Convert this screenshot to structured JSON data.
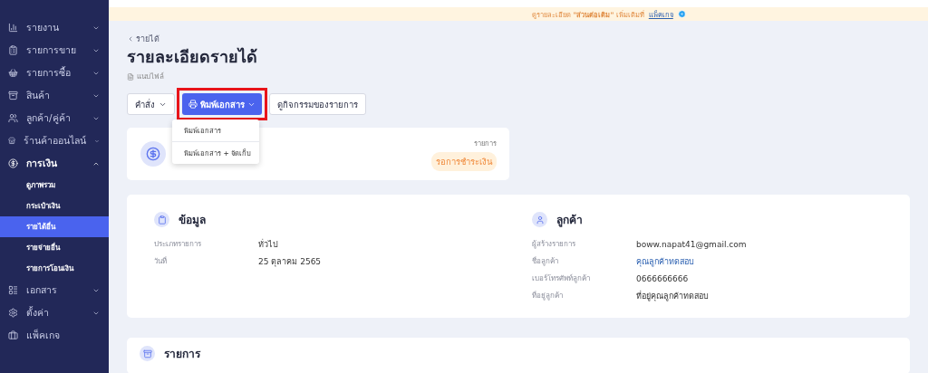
{
  "sidebar": {
    "items": [
      {
        "label": "รายงาน",
        "expanded": false
      },
      {
        "label": "รายการขาย",
        "expanded": false
      },
      {
        "label": "รายการซื้อ",
        "expanded": false
      },
      {
        "label": "สินค้า",
        "expanded": false
      },
      {
        "label": "ลูกค้า/คู่ค้า",
        "expanded": false
      },
      {
        "label": "ร้านค้าออนไลน์",
        "expanded": false
      },
      {
        "label": "การเงิน",
        "expanded": true,
        "children": [
          {
            "label": "ดูภาพรวม",
            "selected": false
          },
          {
            "label": "กระเป๋าเงิน",
            "selected": false
          },
          {
            "label": "รายได้อื่น",
            "selected": true
          },
          {
            "label": "รายจ่ายอื่น",
            "selected": false
          },
          {
            "label": "รายการโอนเงิน",
            "selected": false
          }
        ]
      },
      {
        "label": "เอกสาร",
        "expanded": false
      },
      {
        "label": "ตั้งค่า",
        "expanded": false
      },
      {
        "label": "แพ็คเกจ"
      }
    ]
  },
  "banner": {
    "text": "ดูรายละเอียด **\"ส่วนต่อเติม\"** เพิ่มเติมที่",
    "link": "แพ็คเกจ"
  },
  "breadcrumb": "รายได้",
  "title": "รายละเอียดรายได้",
  "file_link": "แนบไฟล์",
  "toolbar": {
    "command": "คำสั่ง",
    "print": {
      "label": "พิมพ์เอกสาร",
      "highlighted": true
    },
    "activity": "ดูกิจกรรมของรายการ"
  },
  "print_menu": {
    "items": [
      "พิมพ์เอกสาร",
      "พิมพ์เอกสาร + จัดเก็บ"
    ]
  },
  "status_card": {
    "label": "รายการ",
    "status": "รอการชำระเงิน"
  },
  "info": {
    "title": "ข้อมูล",
    "rows": [
      {
        "label": "ประเภทรายการ",
        "value": "ทั่วไป"
      },
      {
        "label": "วันที่",
        "value": "25 ตุลาคม 2565"
      }
    ]
  },
  "customer": {
    "title": "ลูกค้า",
    "rows": [
      {
        "label": "ผู้สร้างรายการ",
        "value": "boww.napat41@gmail.com",
        "link": false
      },
      {
        "label": "ชื่อลูกค้า",
        "value": "คุณลูกค้าทดสอบ",
        "link": true
      },
      {
        "label": "เบอร์โทรศัพท์ลูกค้า",
        "value": "0666666666",
        "link": false
      },
      {
        "label": "ที่อยู่ลูกค้า",
        "value": "ที่อยู่คุณลูกค้าทดสอบ",
        "link": false
      }
    ]
  },
  "items_section": {
    "title": "รายการ"
  }
}
